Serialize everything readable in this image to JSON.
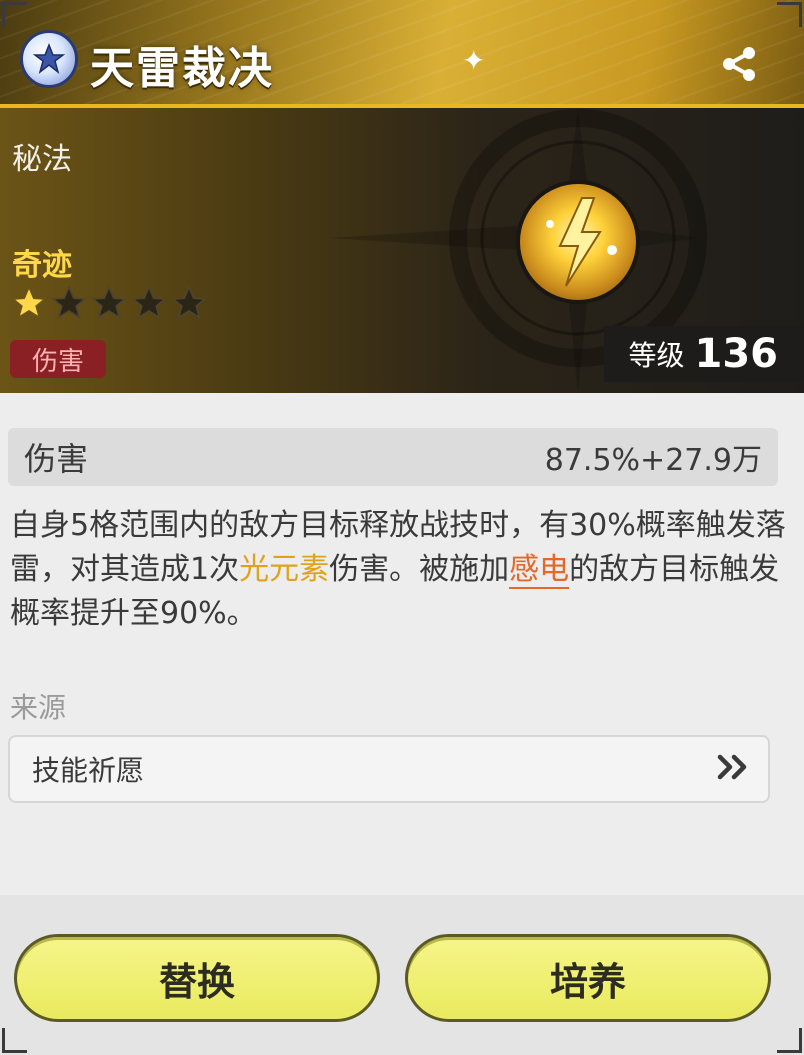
{
  "header": {
    "title": "天雷裁决",
    "emblem_icon": "element-emblem-icon",
    "share_icon": "share-icon"
  },
  "hero": {
    "category": "秘法",
    "rarity": "奇迹",
    "stars": {
      "filled": 1,
      "total": 5
    },
    "tag": "伤害",
    "level_label": "等级",
    "level_value": "136",
    "skill_icon": "lightning-skill-icon"
  },
  "stat": {
    "name": "伤害",
    "value": "87.5%+27.9万"
  },
  "description": {
    "part1": "自身5格范围内的敌方目标释放战技时，有30%概率触发落雷，对其造成1次",
    "highlight1": "光元素",
    "part2": "伤害。被施加",
    "highlight2": "感电",
    "part3": "的敌方目标触发概率提升至90%。"
  },
  "source": {
    "label": "来源",
    "item": "技能祈愿",
    "go_icon": "double-chevron-right-icon"
  },
  "buttons": {
    "replace": "替换",
    "train": "培养"
  },
  "colors": {
    "accent_gold": "#e8b820",
    "highlight_gold": "#e0a21a",
    "highlight_orange": "#e5672a",
    "button_yellow": "#eceb62"
  }
}
